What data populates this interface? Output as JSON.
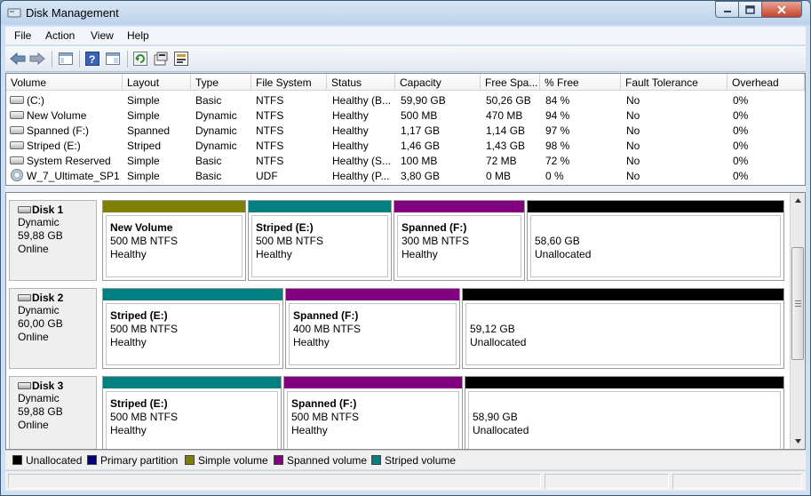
{
  "window": {
    "title": "Disk Management"
  },
  "menu": [
    "File",
    "Action",
    "View",
    "Help"
  ],
  "toolbar": {
    "icons": [
      "back-arrow-icon",
      "forward-arrow-icon",
      "console-tree-icon",
      "help-icon",
      "help-topics-icon",
      "refresh-icon",
      "properties-icon",
      "disk-properties-icon"
    ]
  },
  "volume_list": {
    "columns": [
      "Volume",
      "Layout",
      "Type",
      "File System",
      "Status",
      "Capacity",
      "Free Spa...",
      "% Free",
      "Fault Tolerance",
      "Overhead"
    ],
    "rows": [
      {
        "volume": "(C:)",
        "layout": "Simple",
        "type": "Basic",
        "fs": "NTFS",
        "status": "Healthy (B...",
        "capacity": "59,90 GB",
        "free": "50,26 GB",
        "pct": "84 %",
        "fault": "No",
        "overhead": "0%",
        "icon": "drive"
      },
      {
        "volume": "New Volume",
        "layout": "Simple",
        "type": "Dynamic",
        "fs": "NTFS",
        "status": "Healthy",
        "capacity": "500 MB",
        "free": "470 MB",
        "pct": "94 %",
        "fault": "No",
        "overhead": "0%",
        "icon": "drive"
      },
      {
        "volume": "Spanned (F:)",
        "layout": "Spanned",
        "type": "Dynamic",
        "fs": "NTFS",
        "status": "Healthy",
        "capacity": "1,17 GB",
        "free": "1,14 GB",
        "pct": "97 %",
        "fault": "No",
        "overhead": "0%",
        "icon": "drive"
      },
      {
        "volume": "Striped (E:)",
        "layout": "Striped",
        "type": "Dynamic",
        "fs": "NTFS",
        "status": "Healthy",
        "capacity": "1,46 GB",
        "free": "1,43 GB",
        "pct": "98 %",
        "fault": "No",
        "overhead": "0%",
        "icon": "drive"
      },
      {
        "volume": "System Reserved",
        "layout": "Simple",
        "type": "Basic",
        "fs": "NTFS",
        "status": "Healthy (S...",
        "capacity": "100 MB",
        "free": "72 MB",
        "pct": "72 %",
        "fault": "No",
        "overhead": "0%",
        "icon": "drive"
      },
      {
        "volume": "W_7_Ultimate_SP1...",
        "layout": "Simple",
        "type": "Basic",
        "fs": "UDF",
        "status": "Healthy (P...",
        "capacity": "3,80 GB",
        "free": "0 MB",
        "pct": "0 %",
        "fault": "No",
        "overhead": "0%",
        "icon": "disc"
      }
    ]
  },
  "disks": [
    {
      "name": "Disk 1",
      "type": "Dynamic",
      "size": "59,88 GB",
      "state": "Online",
      "partitions": [
        {
          "name": "New Volume",
          "size": "500 MB NTFS",
          "status": "Healthy",
          "color": "#808000"
        },
        {
          "name": "Striped  (E:)",
          "size": "500 MB NTFS",
          "status": "Healthy",
          "color": "#008080"
        },
        {
          "name": "Spanned  (F:)",
          "size": "300 MB NTFS",
          "status": "Healthy",
          "color": "#800080"
        },
        {
          "name": "",
          "size": "58,60 GB",
          "status": "Unallocated",
          "color": "#000000"
        }
      ]
    },
    {
      "name": "Disk 2",
      "type": "Dynamic",
      "size": "60,00 GB",
      "state": "Online",
      "partitions": [
        {
          "name": "Striped  (E:)",
          "size": "500 MB NTFS",
          "status": "Healthy",
          "color": "#008080"
        },
        {
          "name": "Spanned  (F:)",
          "size": "400 MB NTFS",
          "status": "Healthy",
          "color": "#800080"
        },
        {
          "name": "",
          "size": "59,12 GB",
          "status": "Unallocated",
          "color": "#000000"
        }
      ]
    },
    {
      "name": "Disk 3",
      "type": "Dynamic",
      "size": "59,88 GB",
      "state": "Online",
      "partitions": [
        {
          "name": "Striped  (E:)",
          "size": "500 MB NTFS",
          "status": "Healthy",
          "color": "#008080"
        },
        {
          "name": "Spanned  (F:)",
          "size": "500 MB NTFS",
          "status": "Healthy",
          "color": "#800080"
        },
        {
          "name": "",
          "size": "58,90 GB",
          "status": "Unallocated",
          "color": "#000000"
        }
      ]
    }
  ],
  "legend": [
    {
      "label": "Unallocated",
      "color": "#000000"
    },
    {
      "label": "Primary partition",
      "color": "#000080"
    },
    {
      "label": "Simple volume",
      "color": "#808000"
    },
    {
      "label": "Spanned volume",
      "color": "#800080"
    },
    {
      "label": "Striped volume",
      "color": "#008080"
    }
  ]
}
